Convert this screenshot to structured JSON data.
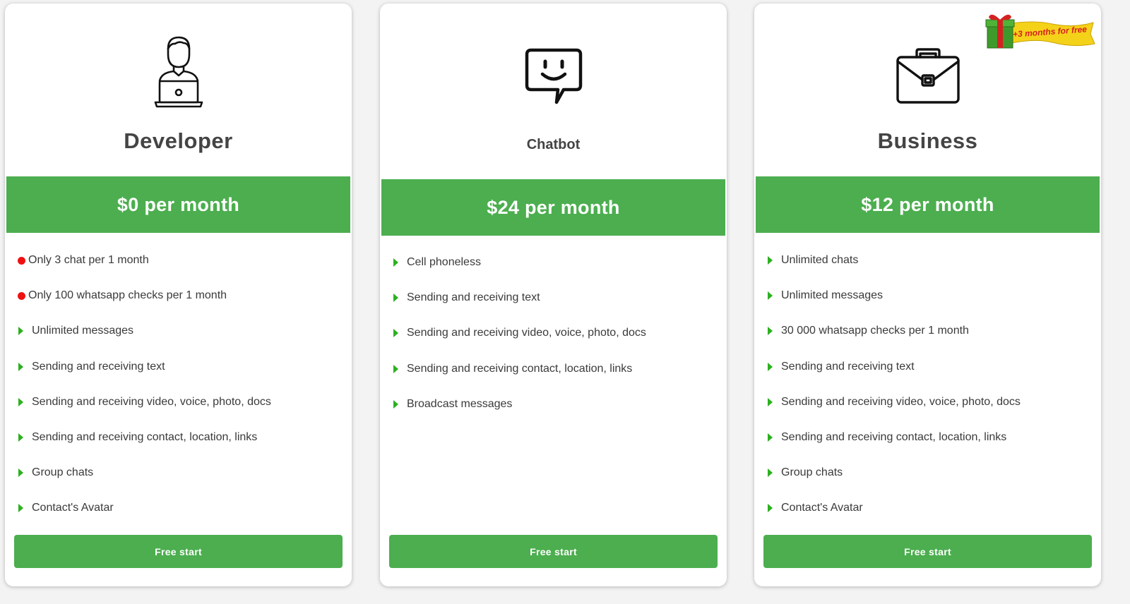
{
  "plans": [
    {
      "title": "Developer",
      "icon": "developer-laptop-icon",
      "price": "$0 per month",
      "features": [
        {
          "marker": "red-dot",
          "text": "Only 3 chat per 1 month"
        },
        {
          "marker": "red-dot",
          "text": "Only 100 whatsapp checks per 1 month"
        },
        {
          "marker": "green-triangle",
          "text": "Unlimited messages"
        },
        {
          "marker": "green-triangle",
          "text": "Sending and receiving text"
        },
        {
          "marker": "green-triangle",
          "text": "Sending and receiving video, voice, photo, docs"
        },
        {
          "marker": "green-triangle",
          "text": "Sending and receiving contact, location, links"
        },
        {
          "marker": "green-triangle",
          "text": "Group chats"
        },
        {
          "marker": "green-triangle",
          "text": "Contact's Avatar"
        }
      ],
      "button": "Free start"
    },
    {
      "title": "Chatbot",
      "icon": "chatbot-smile-icon",
      "price": "$24 per month",
      "features": [
        {
          "marker": "green-triangle",
          "text": "Cell phoneless"
        },
        {
          "marker": "green-triangle",
          "text": "Sending and receiving text"
        },
        {
          "marker": "green-triangle",
          "text": "Sending and receiving video, voice, photo, docs"
        },
        {
          "marker": "green-triangle",
          "text": "Sending and receiving contact, location, links"
        },
        {
          "marker": "green-triangle",
          "text": "Broadcast messages"
        }
      ],
      "button": "Free start"
    },
    {
      "title": "Business",
      "icon": "briefcase-icon",
      "price": "$12 per month",
      "badge": "+3 months for free",
      "features": [
        {
          "marker": "green-triangle",
          "text": "Unlimited chats"
        },
        {
          "marker": "green-triangle",
          "text": "Unlimited messages"
        },
        {
          "marker": "green-triangle",
          "text": "30 000 whatsapp checks per 1 month"
        },
        {
          "marker": "green-triangle",
          "text": "Sending and receiving text"
        },
        {
          "marker": "green-triangle",
          "text": "Sending and receiving video, voice, photo, docs"
        },
        {
          "marker": "green-triangle",
          "text": "Sending and receiving contact, location, links"
        },
        {
          "marker": "green-triangle",
          "text": "Group chats"
        },
        {
          "marker": "green-triangle",
          "text": "Contact's Avatar"
        }
      ],
      "button": "Free start"
    }
  ],
  "colors": {
    "accent": "#4cae4f",
    "triangle": "#2cb01f",
    "dot": "#ee1111",
    "text": "#3a3a3a",
    "heading": "#444444"
  }
}
